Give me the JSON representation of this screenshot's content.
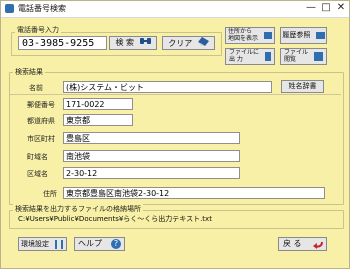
{
  "window": {
    "title": "電話番号検索",
    "minimize": "—",
    "maximize": "□",
    "close": "✕"
  },
  "phone_group": {
    "label": "電話番号入力",
    "phone_value": "03-3985-9255",
    "search_label": "検 索",
    "clear_label": "クリア"
  },
  "side_buttons": {
    "from_address_line1": "住所から",
    "from_address_line2": "地図を表示",
    "history_label": "履歴参照",
    "file_output_line1": "ファイルに",
    "file_output_line2": "出 力",
    "file_view_line1": "ファイル",
    "file_view_line2": "閲覧"
  },
  "results": {
    "label": "検索結果",
    "name_label": "名前",
    "name_value": "(株)システム・ビット",
    "dictionary_button": "姓名辞書",
    "postal_label": "郵便番号",
    "postal_value": "171-0022",
    "prefecture_label": "都道府県",
    "prefecture_value": "東京都",
    "city_label": "市区町村",
    "city_value": "豊島区",
    "town_label": "町域名",
    "town_value": "南池袋",
    "block_label": "区域名",
    "block_value": "2-30-12",
    "address_label": "住所",
    "address_value": "東京都豊島区南池袋2-30-12"
  },
  "output_file": {
    "label": "検索結果を出力するファイルの格納場所",
    "path": "C:¥Users¥Public¥Documents¥らく～くら出力テキスト.txt"
  },
  "footer": {
    "env_label": "環境設定",
    "help_label": "ヘルプ",
    "back_label": "戻 る"
  }
}
